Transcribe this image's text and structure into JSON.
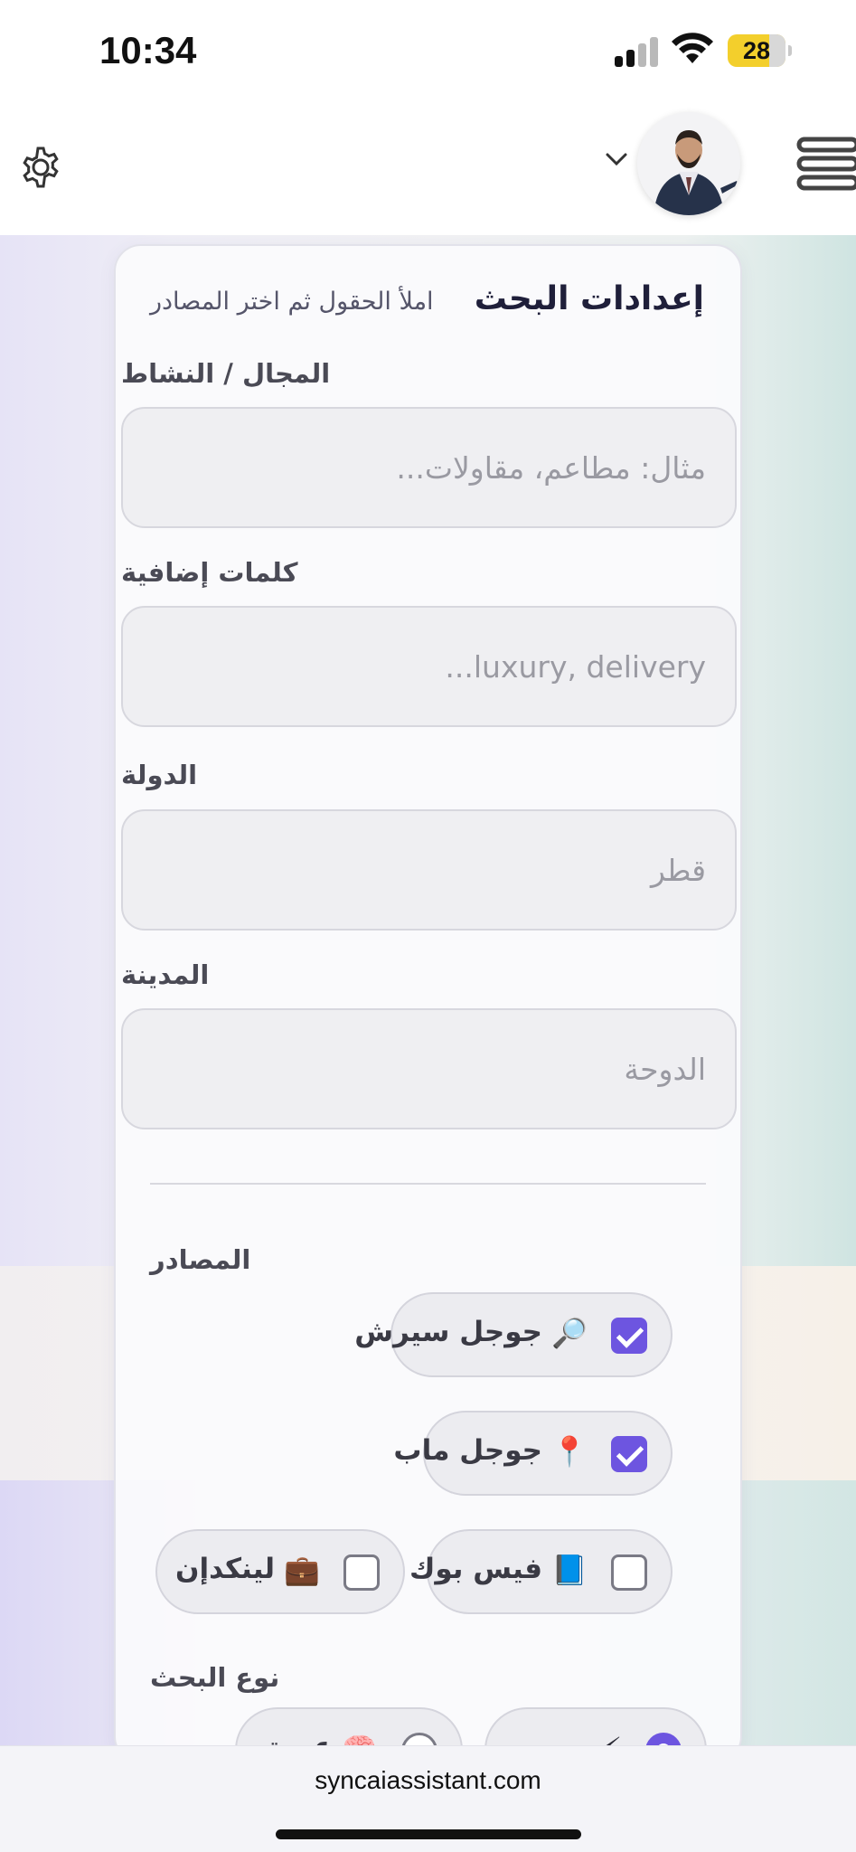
{
  "status_bar": {
    "time": "10:34",
    "battery": "28",
    "icons": [
      "signal-icon",
      "wifi-icon",
      "battery-icon"
    ]
  },
  "header": {
    "icons": [
      "gear-icon",
      "chevron-down-icon",
      "avatar",
      "menu-icon"
    ]
  },
  "card": {
    "title": "إعدادات البحث",
    "subtitle": "املأ الحقول ثم اختر المصادر",
    "fields": [
      {
        "label": "المجال / النشاط",
        "placeholder": "مثال: مطاعم، مقاولات..."
      },
      {
        "label": "كلمات إضافية",
        "placeholder": "luxury, delivery..."
      },
      {
        "label": "الدولة",
        "placeholder": "قطر"
      },
      {
        "label": "المدينة",
        "placeholder": "الدوحة"
      }
    ],
    "sources_label": "المصادر",
    "sources": [
      {
        "label": "جوجل سيرش",
        "emoji": "🔎",
        "checked": true
      },
      {
        "label": "جوجل ماب",
        "emoji": "📍",
        "checked": true
      },
      {
        "label": "فيس بوك",
        "emoji": "📘",
        "checked": false
      },
      {
        "label": "لينكدإن",
        "emoji": "💼",
        "checked": false
      }
    ],
    "search_type_label": "نوع البحث",
    "search_types": [
      {
        "label": "سريع",
        "emoji": "⚡",
        "selected": true
      },
      {
        "label": "عميق",
        "emoji": "🧠",
        "selected": false
      }
    ]
  },
  "browser": {
    "url": "syncaiassistant.com"
  },
  "colors": {
    "accent": "#6d55e0",
    "battery": "#f3cf2c",
    "title": "#1f1f3a"
  }
}
